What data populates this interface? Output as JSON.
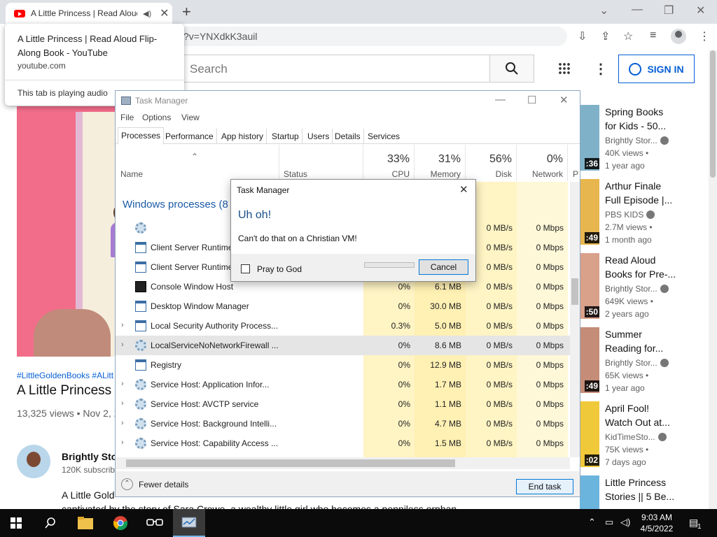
{
  "browser": {
    "tab": {
      "title": "A Little Princess | Read Aloud Flip-Along Book - YouTube",
      "short_title": "A Little Princess | Read Aloud"
    },
    "new_tab": "+",
    "window_controls": {
      "minimize": "—",
      "restore": "❐",
      "close": "✕",
      "tab_list": "⌄"
    },
    "url_fragment": "?v=YNXdkK3auil",
    "tooltip": {
      "title": "A Little Princess | Read Aloud Flip-Along Book - YouTube",
      "url": "youtube.com",
      "audio": "This tab is playing audio"
    }
  },
  "youtube": {
    "search_placeholder": "Search",
    "sign_in": "SIGN IN",
    "hashtags": "#LittleGoldenBooks #ALitt",
    "video_title": "A Little Princess |",
    "views": "13,325 views • Nov 2, 2",
    "channel_name": "Brightly Stor",
    "channel_subs": "120K subscrib",
    "description_1": "A Little Gold",
    "description_2": "captivated by the story of Sara Crewe, a wealthy little girl who becomes a penniless orphan",
    "suggestions": [
      {
        "title": "Spring Books\nfor Kids - 50...",
        "channel": "Brightly Stor...",
        "views": "40K views •",
        "age": "1 year ago",
        "duration": ":36",
        "color": "#7fb2c9"
      },
      {
        "title": "Arthur Finale\nFull Episode |...",
        "channel": "PBS KIDS",
        "views": "2.7M views •",
        "age": "1 month ago",
        "duration": ":49",
        "color": "#e8b64e"
      },
      {
        "title": "Read Aloud\nBooks for Pre-...",
        "channel": "Brightly Stor...",
        "views": "649K views •",
        "age": "2 years ago",
        "duration": ":50",
        "color": "#d9a08a"
      },
      {
        "title": "Summer\nReading for...",
        "channel": "Brightly Stor...",
        "views": "65K views •",
        "age": "1 year ago",
        "duration": ":49",
        "color": "#c58c77"
      },
      {
        "title": "April Fool!\nWatch Out at...",
        "channel": "KidTimeSto...",
        "views": "75K views •",
        "age": "7 days ago",
        "duration": ":02",
        "color": "#f0c93a"
      },
      {
        "title": "Little Princess\nStories || 5 Be...",
        "channel": "",
        "views": "",
        "age": "",
        "duration": "",
        "color": "#6ab4de"
      }
    ]
  },
  "task_manager": {
    "title": "Task Manager",
    "menu": [
      "File",
      "Options",
      "View"
    ],
    "tabs": [
      "Processes",
      "Performance",
      "App history",
      "Startup",
      "Users",
      "Details",
      "Services"
    ],
    "columns": {
      "name": "Name",
      "status": "Status",
      "cpu_pct": "33%",
      "cpu": "CPU",
      "memory_pct": "31%",
      "memory": "Memory",
      "disk_pct": "56%",
      "disk": "Disk",
      "network_pct": "0%",
      "network": "Network",
      "extra": "P"
    },
    "group_title": "Windows processes (8",
    "rows": [
      {
        "name": "",
        "icon": "gear",
        "cpu": "",
        "memory": "",
        "disk": "0 MB/s",
        "network": "0 Mbps",
        "expand": false
      },
      {
        "name": "Client Server Runtime Process",
        "icon": "win",
        "cpu": "",
        "memory": "",
        "disk": "0 MB/s",
        "network": "0 Mbps",
        "expand": false
      },
      {
        "name": "Client Server Runtime Process",
        "icon": "win",
        "cpu": "",
        "memory": "",
        "disk": "0 MB/s",
        "network": "0 Mbps",
        "expand": false
      },
      {
        "name": "Console Window Host",
        "icon": "con",
        "cpu": "0%",
        "memory": "6.1 MB",
        "disk": "0 MB/s",
        "network": "0 Mbps",
        "expand": false
      },
      {
        "name": "Desktop Window Manager",
        "icon": "win",
        "cpu": "0%",
        "memory": "30.0 MB",
        "disk": "0 MB/s",
        "network": "0 Mbps",
        "expand": false
      },
      {
        "name": "Local Security Authority Process...",
        "icon": "win",
        "cpu": "0.3%",
        "memory": "5.0 MB",
        "disk": "0 MB/s",
        "network": "0 Mbps",
        "expand": true
      },
      {
        "name": "LocalServiceNoNetworkFirewall ...",
        "icon": "gear",
        "cpu": "0%",
        "memory": "8.6 MB",
        "disk": "0 MB/s",
        "network": "0 Mbps",
        "expand": true,
        "selected": true
      },
      {
        "name": "Registry",
        "icon": "win",
        "cpu": "0%",
        "memory": "12.9 MB",
        "disk": "0 MB/s",
        "network": "0 Mbps",
        "expand": false
      },
      {
        "name": "Service Host: Application Infor...",
        "icon": "gear",
        "cpu": "0%",
        "memory": "1.7 MB",
        "disk": "0 MB/s",
        "network": "0 Mbps",
        "expand": true
      },
      {
        "name": "Service Host: AVCTP service",
        "icon": "gear",
        "cpu": "0%",
        "memory": "1.1 MB",
        "disk": "0 MB/s",
        "network": "0 Mbps",
        "expand": true
      },
      {
        "name": "Service Host: Background Intelli...",
        "icon": "gear",
        "cpu": "0%",
        "memory": "4.7 MB",
        "disk": "0 MB/s",
        "network": "0 Mbps",
        "expand": true
      },
      {
        "name": "Service Host: Capability Access ...",
        "icon": "gear",
        "cpu": "0%",
        "memory": "1.5 MB",
        "disk": "0 MB/s",
        "network": "0 Mbps",
        "expand": true
      }
    ],
    "fewer_details": "Fewer details",
    "end_task": "End task"
  },
  "dialog": {
    "title": "Task Manager",
    "heading": "Uh oh!",
    "message": "Can't do that on a Christian VM!",
    "checkbox_label": "Pray to God",
    "cancel": "Cancel"
  },
  "taskbar": {
    "time": "9:03 AM",
    "date": "4/5/2022",
    "notification_count": "1"
  },
  "colors": {
    "accent": "#065fd4",
    "tm_highlight": "#fff4c4",
    "youtube_red": "#ff0000",
    "taskbar": "#0b0b0b"
  }
}
